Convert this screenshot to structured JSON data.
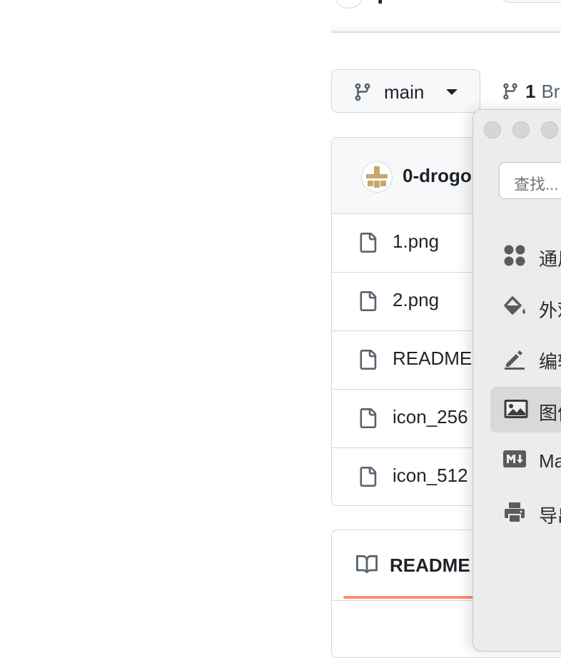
{
  "repo": {
    "name": "p"
  },
  "branch": {
    "current": "main",
    "count": "1",
    "count_label": "Br"
  },
  "commit": {
    "author": "0-drogo"
  },
  "files": [
    {
      "name": "1.png"
    },
    {
      "name": "2.png"
    },
    {
      "name": "README"
    },
    {
      "name": "icon_256"
    },
    {
      "name": "icon_512"
    }
  ],
  "readme": {
    "title": "README"
  },
  "settings": {
    "search_placeholder": "查找...",
    "nav": [
      {
        "label": "通用",
        "icon": "grid-icon"
      },
      {
        "label": "外观",
        "icon": "paint-bucket-icon"
      },
      {
        "label": "编辑",
        "icon": "pencil-icon"
      },
      {
        "label": "图像",
        "icon": "image-icon",
        "selected": true
      },
      {
        "label": "Markdown",
        "icon": "markdown-icon"
      },
      {
        "label": "导出",
        "icon": "printer-icon"
      }
    ]
  },
  "colors": {
    "accent_underline": "#fd8c73",
    "border": "#d0d7de",
    "selected_nav": "#d9d9d9"
  }
}
